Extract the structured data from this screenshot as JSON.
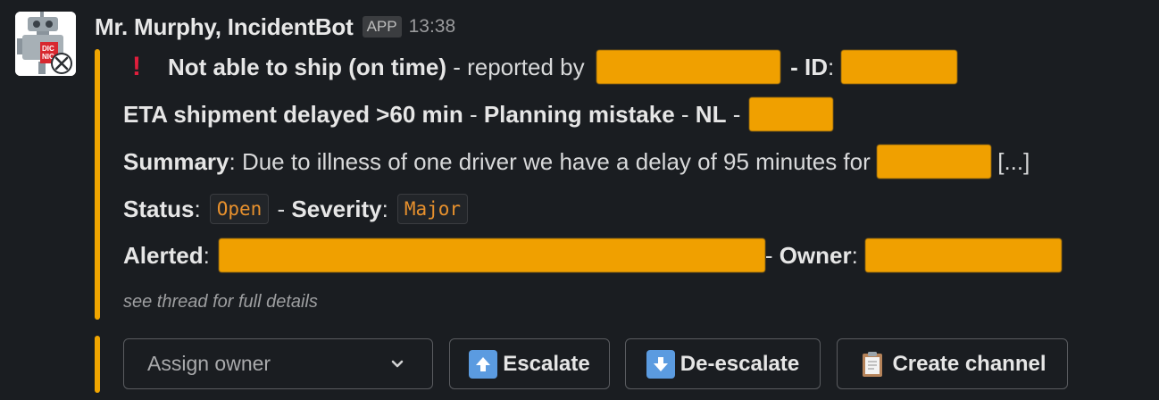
{
  "message": {
    "sender": "Mr. Murphy, IncidentBot",
    "app_badge": "APP",
    "time": "13:38"
  },
  "incident": {
    "alert_icon": "!",
    "title": "Not able to ship (on time)",
    "reported_by_text": " - reported by ",
    "id_sep": " - ID",
    "colon": ":",
    "category": "ETA shipment delayed >60 min",
    "cause": "Planning mistake",
    "country": "NL",
    "dash": " - ",
    "summary_label": "Summary",
    "summary_text": ": Due to illness of one driver we have a delay of 95 minutes for ",
    "summary_ellipsis": " [...]",
    "status_label": "Status",
    "status_value": "Open",
    "severity_label": "Severity",
    "severity_value": "Major",
    "alerted_label": "Alerted",
    "owner_label": "Owner",
    "footnote": "see thread for full details"
  },
  "actions": {
    "assign_placeholder": "Assign owner",
    "escalate": "Escalate",
    "deescalate": "De-escalate",
    "create_channel": "Create channel"
  },
  "colors": {
    "accent_bar": "#f0a500",
    "background": "#1a1d21",
    "code_text": "#e8912d",
    "alert_red": "#e01e3c"
  }
}
